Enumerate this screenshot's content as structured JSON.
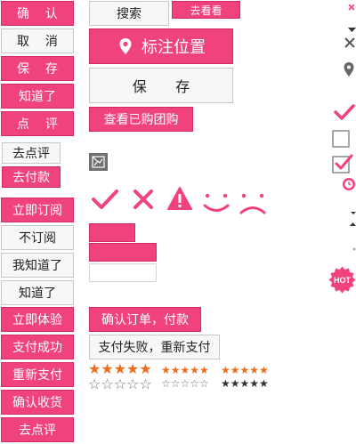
{
  "left_buttons": [
    "确 认",
    "取 消",
    "保 存",
    "知道了",
    "点 评",
    "去点评",
    "去付款",
    "立即订阅",
    "不订阅",
    "我知道了",
    "知道了",
    "立即体验",
    "支付成功",
    "重新支付",
    "确认收货",
    "去点评"
  ],
  "middle": {
    "search_label": "搜索",
    "view_label": "去看看",
    "mark_location_label": "标注位置",
    "save_label": "保 存",
    "view_purchased_label": "查看已购团购",
    "confirm_pay_label": "确认订单，付款",
    "pay_failed_label": "支付失败，重新支付"
  },
  "ratings": {
    "large_filled": "★★★★★",
    "large_empty": "☆☆☆☆☆",
    "small_filled": "★★★★★",
    "small_empty": "☆☆☆☆☆",
    "tiny_filled": "★★★★★",
    "tiny_dark": "★★★★★"
  },
  "hot_badge": "HOT",
  "icons": [
    "check-icon",
    "close-icon",
    "warning-icon",
    "smile-icon",
    "sad-icon",
    "location-pin-icon",
    "image-placeholder-icon",
    "checkbox-empty-icon",
    "checkbox-checked-icon",
    "clock-icon",
    "caret-down-icon",
    "caret-up-icon",
    "dot-icon"
  ],
  "colors": {
    "primary": "#f0437b",
    "primary_border": "#d22d63",
    "neutral_bg": "#f7f7f7",
    "neutral_border": "#c8c8c8",
    "star_orange": "#ef6d1a",
    "icon_grey": "#555555"
  }
}
